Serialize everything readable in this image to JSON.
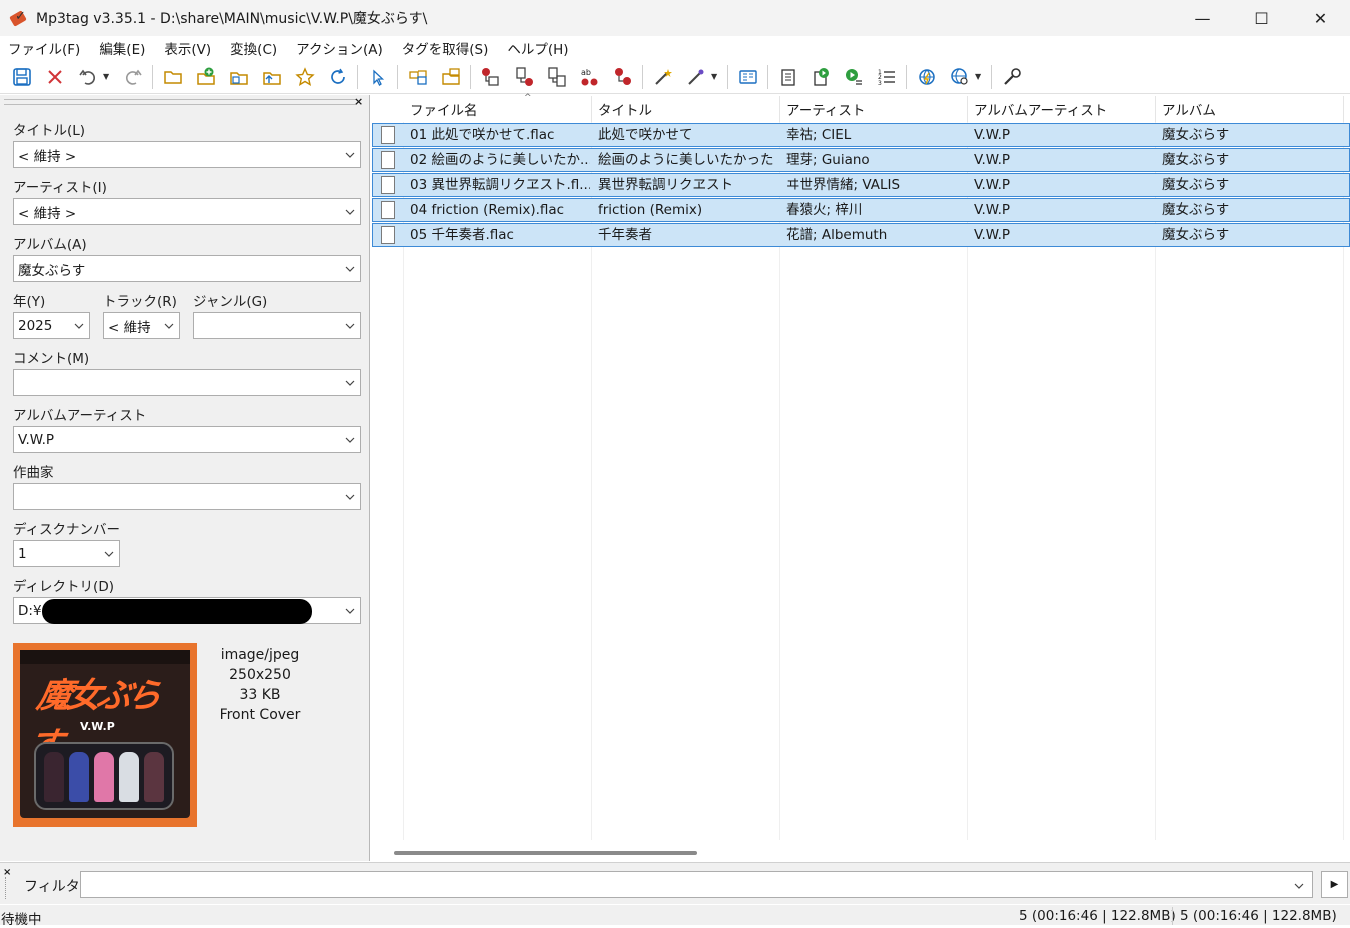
{
  "window": {
    "title": "Mp3tag v3.35.1  -  D:\\share\\MAIN\\music\\V.W.P\\魔女ぶらす\\",
    "minimize": "—",
    "maximize": "☐",
    "close": "✕"
  },
  "menu": [
    "ファイル(F)",
    "編集(E)",
    "表示(V)",
    "変換(C)",
    "アクション(A)",
    "タグを取得(S)",
    "ヘルプ(H)"
  ],
  "toolbar_icons": [
    "save-icon",
    "remove-tag-icon",
    "undo-icon",
    "redo-icon",
    "open-folder-icon",
    "add-folder-icon",
    "import-icon",
    "export-icon",
    "favorite-icon",
    "refresh-icon",
    "select-icon",
    "tag-from-filename-icon",
    "filename-from-tag-icon",
    "filename-rename-icon",
    "text-file-icon",
    "case-convert-icon",
    "auto-number-icon",
    "actions-icon",
    "quick-action-icon",
    "extended-tags-icon",
    "export-list-icon",
    "playlist-icon",
    "play-icon",
    "numbering-icon",
    "web-source-icon",
    "web-source-search-icon",
    "options-icon"
  ],
  "tag_panel": {
    "title": {
      "label": "タイトル(L)",
      "value": "< 維持 >"
    },
    "artist": {
      "label": "アーティスト(I)",
      "value": "< 維持 >"
    },
    "album": {
      "label": "アルバム(A)",
      "value": "魔女ぶらす"
    },
    "year": {
      "label": "年(Y)",
      "value": "2025"
    },
    "track": {
      "label": "トラック(R)",
      "value": "< 維持"
    },
    "genre": {
      "label": "ジャンル(G)",
      "value": ""
    },
    "comment": {
      "label": "コメント(M)",
      "value": ""
    },
    "album_artist": {
      "label": "アルバムアーティスト",
      "value": "V.W.P"
    },
    "composer": {
      "label": "作曲家",
      "value": ""
    },
    "disc": {
      "label": "ディスクナンバー",
      "value": "1"
    },
    "directory": {
      "label": "ディレクトリ(D)",
      "value": "D:¥"
    },
    "cover": {
      "mime": "image/jpeg",
      "dimensions": "250x250",
      "size": "33 KB",
      "type": "Front Cover",
      "art_text": "魔女ぶらす",
      "art_sub": "V.W.P"
    }
  },
  "file_list": {
    "columns": [
      "ファイル名",
      "タイトル",
      "アーティスト",
      "アルバムアーティスト",
      "アルバム"
    ],
    "rows": [
      {
        "filename": "01 此処で咲かせて.flac",
        "title": "此処で咲かせて",
        "artist": "幸祜; CIEL",
        "album_artist": "V.W.P",
        "album": "魔女ぶらす"
      },
      {
        "filename": "02 絵画のように美しいたか...",
        "title": "絵画のように美しいたかった",
        "artist": "理芽; Guiano",
        "album_artist": "V.W.P",
        "album": "魔女ぶらす"
      },
      {
        "filename": "03 異世界転調リクヱスト.fl...",
        "title": "異世界転調リクヱスト",
        "artist": "ヰ世界情緒; VALIS",
        "album_artist": "V.W.P",
        "album": "魔女ぶらす"
      },
      {
        "filename": "04 friction (Remix).flac",
        "title": "friction (Remix)",
        "artist": "春猿火; 梓川",
        "album_artist": "V.W.P",
        "album": "魔女ぶらす"
      },
      {
        "filename": "05 千年奏者.flac",
        "title": "千年奏者",
        "artist": "花譜; Albemuth",
        "album_artist": "V.W.P",
        "album": "魔女ぶらす"
      }
    ]
  },
  "filter": {
    "label": "フィルタ",
    "value": ""
  },
  "status": {
    "left": "待機中",
    "selected": "5 (00:16:46 | 122.8MB)",
    "total": "5 (00:16:46 | 122.8MB)"
  },
  "colors": {
    "selection": "#cce4f7",
    "selection_border": "#3d8ad6",
    "cover_frame": "#e8742d"
  }
}
